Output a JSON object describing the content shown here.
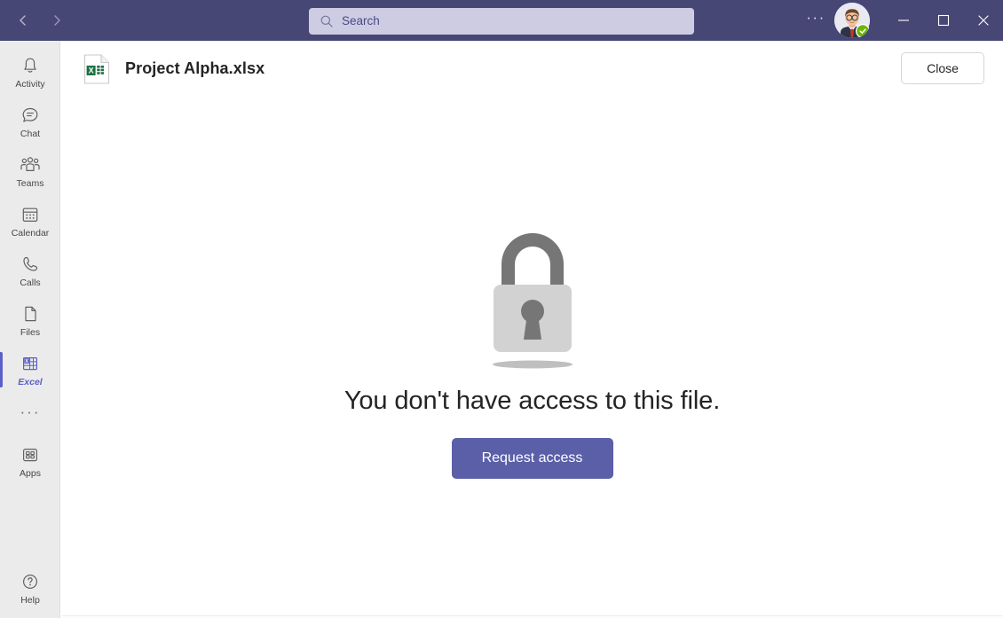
{
  "titlebar": {
    "back_icon": "chevron-left-icon",
    "forward_icon": "chevron-right-icon",
    "search": {
      "placeholder": "Search",
      "value": "",
      "icon": "search-icon"
    },
    "more_label": "···",
    "avatar": {
      "name": "user-avatar",
      "presence": "available"
    },
    "window_controls": {
      "minimize": "minimize-icon",
      "maximize": "maximize-icon",
      "close": "close-icon"
    },
    "accent_color": "#464775"
  },
  "sidebar": {
    "items": [
      {
        "id": "activity",
        "label": "Activity",
        "icon": "bell-icon",
        "selected": false
      },
      {
        "id": "chat",
        "label": "Chat",
        "icon": "chat-bubble-icon",
        "selected": false
      },
      {
        "id": "teams",
        "label": "Teams",
        "icon": "people-icon",
        "selected": false
      },
      {
        "id": "calendar",
        "label": "Calendar",
        "icon": "calendar-icon",
        "selected": false
      },
      {
        "id": "calls",
        "label": "Calls",
        "icon": "phone-icon",
        "selected": false
      },
      {
        "id": "files",
        "label": "Files",
        "icon": "document-icon",
        "selected": false
      },
      {
        "id": "excel",
        "label": "Excel",
        "icon": "excel-icon",
        "selected": true
      }
    ],
    "more_label": "···",
    "apps": {
      "label": "Apps",
      "icon": "apps-grid-icon"
    },
    "help": {
      "label": "Help",
      "icon": "question-circle-icon"
    },
    "selected_color": "#5b5fc7"
  },
  "file_header": {
    "file_name": "Project Alpha.xlsx",
    "file_icon": "excel-file-icon",
    "close_label": "Close"
  },
  "empty_state": {
    "illustration": "padlock-icon",
    "message": "You don't have access to this file.",
    "primary_action": "Request access",
    "primary_action_color": "#5b5fa8"
  }
}
